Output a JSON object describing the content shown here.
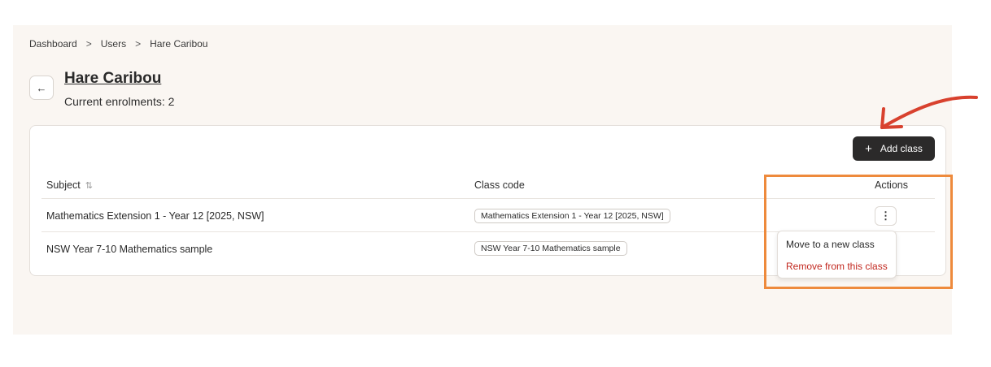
{
  "breadcrumb": {
    "items": [
      "Dashboard",
      "Users",
      "Hare Caribou"
    ],
    "separator": ">"
  },
  "header": {
    "back_icon": "arrow-left-icon",
    "title": "Hare Caribou",
    "subtitle": "Current enrolments: 2"
  },
  "toolbar": {
    "add_icon": "plus-icon",
    "add_label": "Add class"
  },
  "table": {
    "columns": {
      "subject": "Subject",
      "sort_icon": "sort-icon",
      "class_code": "Class code",
      "actions": "Actions"
    },
    "rows": [
      {
        "subject": "Mathematics Extension 1 - Year 12 [2025, NSW]",
        "class_code": "Mathematics Extension 1 - Year 12 [2025, NSW]"
      },
      {
        "subject": "NSW Year 7-10 Mathematics sample",
        "class_code": "NSW Year 7-10 Mathematics sample"
      }
    ],
    "actions_icon": "more-vertical-icon"
  },
  "actions_menu": {
    "items": [
      "Move to a new class",
      "Remove from this class"
    ]
  },
  "colors": {
    "background": "#faf6f2",
    "primary_button": "#2b2a2a",
    "danger_text": "#c2281f",
    "highlight_border": "#ee8a3c",
    "annotation_arrow": "#d8412e"
  }
}
